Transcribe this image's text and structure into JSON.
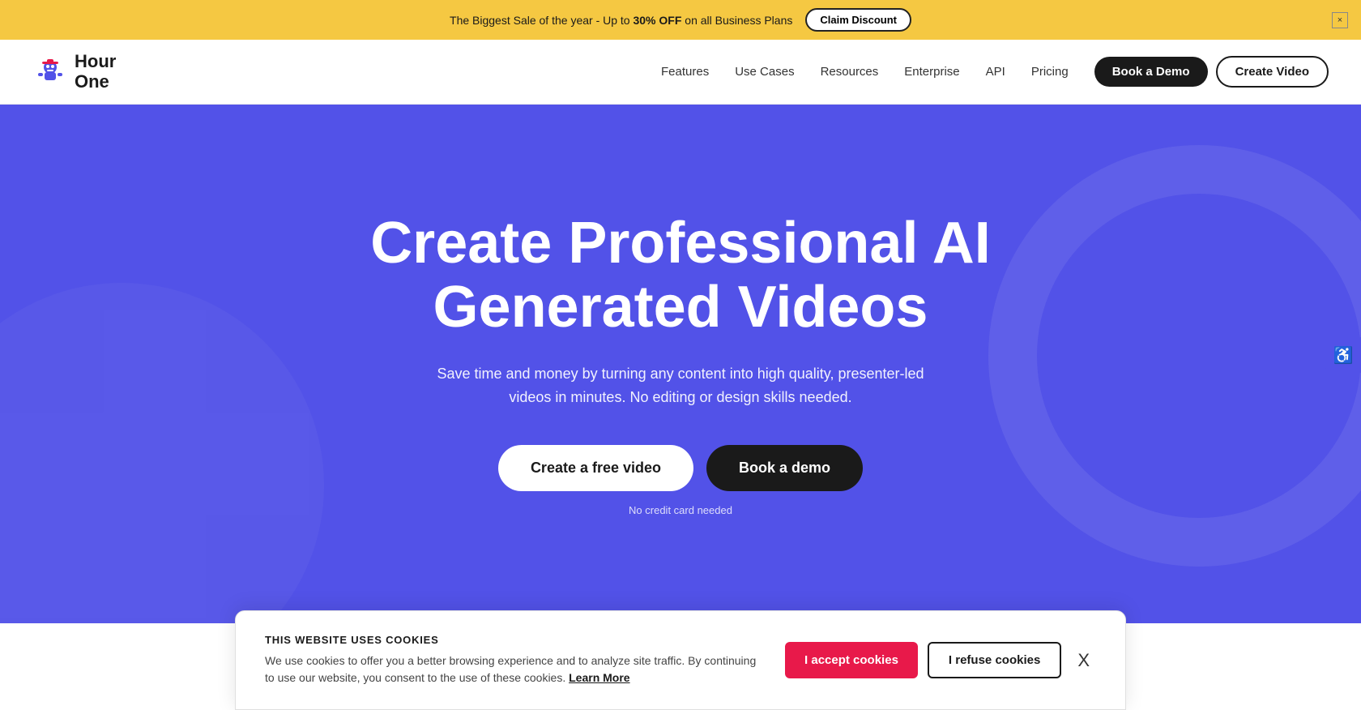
{
  "announcement": {
    "text_before_bold": "The Biggest Sale of the year - Up to ",
    "bold_text": "30% OFF",
    "text_after_bold": " on all Business Plans",
    "claim_label": "Claim Discount",
    "close_label": "×"
  },
  "navbar": {
    "logo_text_line1": "Hour",
    "logo_text_line2": "One",
    "nav_links": [
      {
        "label": "Features",
        "href": "#"
      },
      {
        "label": "Use Cases",
        "href": "#"
      },
      {
        "label": "Resources",
        "href": "#"
      },
      {
        "label": "Enterprise",
        "href": "#"
      },
      {
        "label": "API",
        "href": "#"
      },
      {
        "label": "Pricing",
        "href": "#"
      }
    ],
    "book_demo_label": "Book a Demo",
    "create_video_label": "Create Video"
  },
  "hero": {
    "title": "Create Professional AI Generated Videos",
    "subtitle": "Save time and money by turning any content into high quality, presenter-led videos in minutes. No editing or design skills needed.",
    "create_free_video_label": "Create a free video",
    "book_demo_label": "Book a demo",
    "no_credit_label": "No credit card needed"
  },
  "cookie": {
    "title": "THIS WEBSITE USES COOKIES",
    "body": "We use cookies to offer you a better browsing experience and to analyze site traffic. By continuing to use our website, you consent to the use of these cookies.",
    "learn_more_label": "Learn More",
    "accept_label": "I accept cookies",
    "refuse_label": "I refuse cookies",
    "close_label": "X"
  },
  "accessibility": {
    "icon": "♿"
  }
}
